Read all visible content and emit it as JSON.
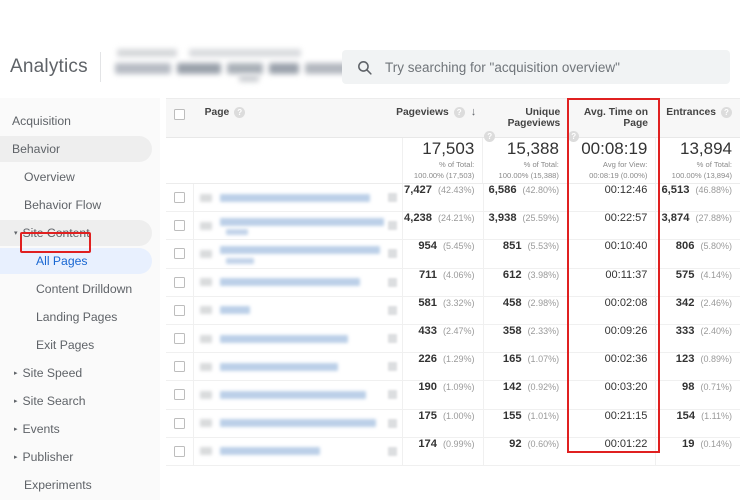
{
  "app": {
    "brand": "Analytics",
    "account_blurred": true
  },
  "search": {
    "placeholder": "Try searching for \"acquisition overview\"",
    "value": "",
    "icon": "search-icon"
  },
  "sidebar": {
    "items": [
      {
        "label": "Acquisition",
        "level": 0,
        "state": "normal",
        "caret": ""
      },
      {
        "label": "Behavior",
        "level": 0,
        "state": "pill",
        "caret": ""
      },
      {
        "label": "Overview",
        "level": 1,
        "state": "normal",
        "caret": ""
      },
      {
        "label": "Behavior Flow",
        "level": 1,
        "state": "normal",
        "caret": ""
      },
      {
        "label": "Site Content",
        "level": 1,
        "state": "pill",
        "caret": "▾"
      },
      {
        "label": "All Pages",
        "level": 2,
        "state": "selected",
        "caret": ""
      },
      {
        "label": "Content Drilldown",
        "level": 2,
        "state": "normal",
        "caret": ""
      },
      {
        "label": "Landing Pages",
        "level": 2,
        "state": "normal",
        "caret": ""
      },
      {
        "label": "Exit Pages",
        "level": 2,
        "state": "normal",
        "caret": ""
      },
      {
        "label": "Site Speed",
        "level": 1,
        "state": "normal",
        "caret": "▸"
      },
      {
        "label": "Site Search",
        "level": 1,
        "state": "normal",
        "caret": "▸"
      },
      {
        "label": "Events",
        "level": 1,
        "state": "normal",
        "caret": "▸"
      },
      {
        "label": "Publisher",
        "level": 1,
        "state": "normal",
        "caret": "▸"
      },
      {
        "label": "Experiments",
        "level": 1,
        "state": "normal",
        "caret": ""
      }
    ]
  },
  "highlights": {
    "color": "#e02020",
    "all_pages_box": true,
    "avg_time_column_box": true
  },
  "table": {
    "columns": [
      {
        "key": "page",
        "label": "Page",
        "help": "?"
      },
      {
        "key": "pageviews",
        "label": "Pageviews",
        "help": "?",
        "sort": "↓"
      },
      {
        "key": "unique_pageviews",
        "label": "Unique Pageviews",
        "help": "?"
      },
      {
        "key": "avg_time_on_page",
        "label": "Avg. Time on Page",
        "help": "?"
      },
      {
        "key": "entrances",
        "label": "Entrances",
        "help": "?"
      }
    ],
    "summary": {
      "pageviews": {
        "value": "17,503",
        "sub1": "% of Total:",
        "sub2": "100.00% (17,503)"
      },
      "unique_pageviews": {
        "value": "15,388",
        "sub1": "% of Total:",
        "sub2": "100.00% (15,388)"
      },
      "avg_time_on_page": {
        "value": "00:08:19",
        "sub1": "Avg for View:",
        "sub2": "00:08:19 (0.00%)"
      },
      "entrances": {
        "value": "13,894",
        "sub1": "% of Total:",
        "sub2": "100.00% (13,894)"
      }
    },
    "rows": [
      {
        "pv": "7,427",
        "pv_pct": "(42.43%)",
        "upv": "6,586",
        "upv_pct": "(42.80%)",
        "time": "00:12:46",
        "ent": "6,513",
        "ent_pct": "(46.88%)",
        "lines": 1,
        "w1": 150
      },
      {
        "pv": "4,238",
        "pv_pct": "(24.21%)",
        "upv": "3,938",
        "upv_pct": "(25.59%)",
        "time": "00:22:57",
        "ent": "3,874",
        "ent_pct": "(27.88%)",
        "lines": 2,
        "w1": 164,
        "w2": 22
      },
      {
        "pv": "954",
        "pv_pct": "(5.45%)",
        "upv": "851",
        "upv_pct": "(5.53%)",
        "time": "00:10:40",
        "ent": "806",
        "ent_pct": "(5.80%)",
        "lines": 2,
        "w1": 160,
        "w2": 28
      },
      {
        "pv": "711",
        "pv_pct": "(4.06%)",
        "upv": "612",
        "upv_pct": "(3.98%)",
        "time": "00:11:37",
        "ent": "575",
        "ent_pct": "(4.14%)",
        "lines": 1,
        "w1": 140
      },
      {
        "pv": "581",
        "pv_pct": "(3.32%)",
        "upv": "458",
        "upv_pct": "(2.98%)",
        "time": "00:02:08",
        "ent": "342",
        "ent_pct": "(2.46%)",
        "lines": 1,
        "w1": 30
      },
      {
        "pv": "433",
        "pv_pct": "(2.47%)",
        "upv": "358",
        "upv_pct": "(2.33%)",
        "time": "00:09:26",
        "ent": "333",
        "ent_pct": "(2.40%)",
        "lines": 1,
        "w1": 128
      },
      {
        "pv": "226",
        "pv_pct": "(1.29%)",
        "upv": "165",
        "upv_pct": "(1.07%)",
        "time": "00:02:36",
        "ent": "123",
        "ent_pct": "(0.89%)",
        "lines": 1,
        "w1": 118
      },
      {
        "pv": "190",
        "pv_pct": "(1.09%)",
        "upv": "142",
        "upv_pct": "(0.92%)",
        "time": "00:03:20",
        "ent": "98",
        "ent_pct": "(0.71%)",
        "lines": 1,
        "w1": 146
      },
      {
        "pv": "175",
        "pv_pct": "(1.00%)",
        "upv": "155",
        "upv_pct": "(1.01%)",
        "time": "00:21:15",
        "ent": "154",
        "ent_pct": "(1.11%)",
        "lines": 1,
        "w1": 156
      },
      {
        "pv": "174",
        "pv_pct": "(0.99%)",
        "upv": "92",
        "upv_pct": "(0.60%)",
        "time": "00:01:22",
        "ent": "19",
        "ent_pct": "(0.14%)",
        "lines": 1,
        "w1": 100
      }
    ]
  }
}
